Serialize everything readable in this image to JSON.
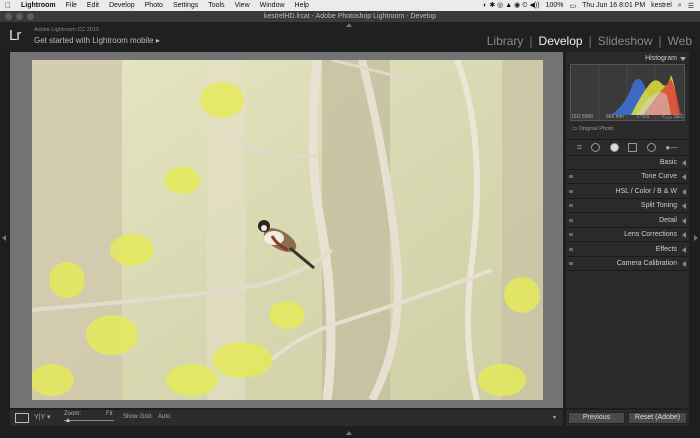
{
  "menubar": {
    "app": "Lightroom",
    "items": [
      "File",
      "Edit",
      "Develop",
      "Photo",
      "Settings",
      "Tools",
      "View",
      "Window",
      "Help"
    ],
    "battery": "100%",
    "clock": "Thu Jun 16  8:01 PM",
    "user": "kestrel"
  },
  "window": {
    "title": "kestrelHD.lrcat - Adobe Photoshop Lightroom - Develop"
  },
  "identity": {
    "logo": "Lr",
    "version": "Adobe Lightroom CC 2015",
    "mobile": "Get started with Lightroom mobile ▸"
  },
  "modules": [
    "Library",
    "Develop",
    "Slideshow",
    "Web"
  ],
  "active_module": "Develop",
  "histogram": {
    "label": "Histogram",
    "iso": "ISO 5000",
    "focal": "566 mm",
    "aperture": "f / 5.6",
    "shutter": "¹⁄₁₆₀₀ SEC",
    "original": "Original Photo"
  },
  "panels": [
    {
      "name": "basic",
      "label": "Basic"
    },
    {
      "name": "tone-curve",
      "label": "Tone Curve"
    },
    {
      "name": "hsl",
      "label": "HSL  /  Color  /  B & W"
    },
    {
      "name": "split-toning",
      "label": "Split Toning"
    },
    {
      "name": "detail",
      "label": "Detail"
    },
    {
      "name": "lens-corrections",
      "label": "Lens Corrections"
    },
    {
      "name": "effects",
      "label": "Effects"
    },
    {
      "name": "camera-calibration",
      "label": "Camera Calibration"
    }
  ],
  "toolbar": {
    "zoom_label": "Zoom:",
    "zoom_value": "Fit",
    "grid_label": "Show Grid:",
    "grid_value": "Auto"
  },
  "buttons": {
    "previous": "Previous",
    "reset": "Reset (Adobe)"
  },
  "colors": {
    "bg": "#1e1e1e",
    "panel": "#2a2a2a",
    "canvas": "#737373"
  }
}
